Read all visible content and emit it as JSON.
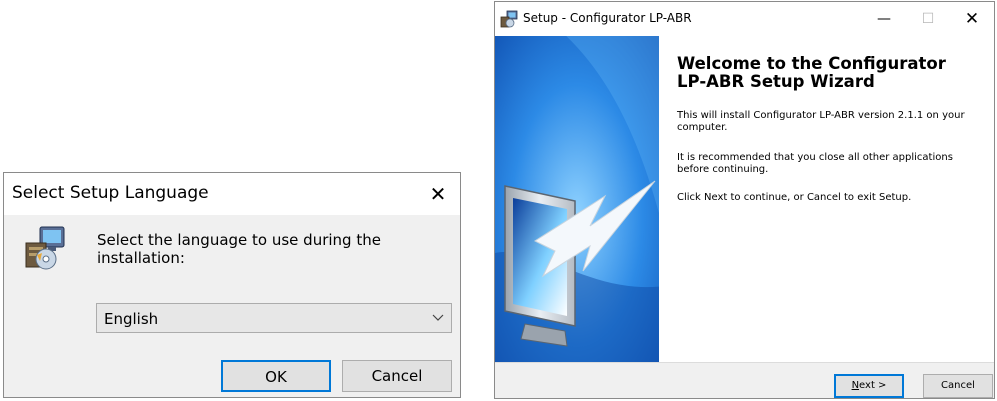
{
  "language_dialog": {
    "title": "Select Setup Language",
    "close_glyph": "✕",
    "prompt": "Select the language to use during the installation:",
    "selected_language": "English",
    "ok_label": "OK",
    "cancel_label": "Cancel",
    "icon": "setup-installer-icon"
  },
  "wizard": {
    "window_title": "Setup - Configurator LP-ABR",
    "minimize_glyph": "—",
    "maximize_glyph": "☐",
    "close_glyph": "✕",
    "heading": "Welcome to the Configurator LP-ABR Setup Wizard",
    "paragraphs": [
      "This will install Configurator LP-ABR version 2.1.1 on your computer.",
      "It is recommended that you close all other applications before continuing.",
      "Click Next to continue, or Cancel to exit Setup."
    ],
    "next_label_mnemonic": "N",
    "next_label_rest": "ext >",
    "cancel_label": "Cancel",
    "side_image": "monitor-with-arrow-icon"
  },
  "colors": {
    "accent": "#0078d7",
    "side_panel": "#1e73cf"
  }
}
